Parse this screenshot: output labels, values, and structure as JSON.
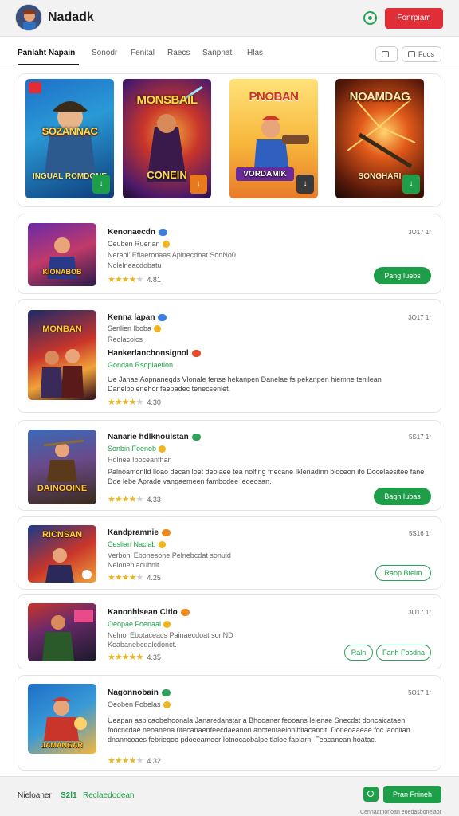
{
  "header": {
    "title": "Nadadk",
    "action_label": "Fonrpiam"
  },
  "tabs": [
    {
      "label": "Panlaht  Napain"
    },
    {
      "label": "Sonodr"
    },
    {
      "label": "Fenital"
    },
    {
      "label": "Raecs"
    },
    {
      "label": "Sanpnat"
    },
    {
      "label": "Hlas"
    }
  ],
  "toolbar": {
    "pill1": "",
    "pill2": "Fdos"
  },
  "featured": [
    {
      "title": "SOZANNAC",
      "subtitle": "INGUAL ROMDONE"
    },
    {
      "title": "MONSBAIL",
      "subtitle": "CONEIN"
    },
    {
      "title": "PNOBAN",
      "subtitle": "VORDAMIK"
    },
    {
      "title": "NOAMDAG",
      "subtitle": "SONGHARI"
    }
  ],
  "games": [
    {
      "title": "Kenonaecdn",
      "genre": "Ceuben  Ruerian",
      "line1": "Neraol'  Efiaeronaas  Apinecdoat  SonNo0",
      "line2": "Nolelneacdobatu",
      "rating": "4.81",
      "time": "3O17 1r",
      "button": "Pang Iuebs",
      "thumb": "KIONABOB"
    },
    {
      "title": "Kenna  lapan",
      "genre": "Senlien  Iboba",
      "line1": "Reolacoics",
      "subtitle2": "Hankerlanchonsignol",
      "subgreen": "Gondan  Rsoplaetion",
      "desc": "Ue Janae Aopnanegds Vlonale fense hekanpen Danelae fs pekanpen hiemne tenilean Danelbolenehor faepadec tenecsenlet.",
      "rating": "4.30",
      "time": "3O17 1r",
      "thumb": "MONBAN"
    },
    {
      "title": "Nanarie  hdlknoulstan",
      "genre": "Sonbin  Foenob",
      "line1": "Hdlnee  Iboceanfhan",
      "desc": "Palnoamonlld  lloao decan  loet deolaee  tea nolfing fnecane  Iklenadinn  bloceon  ifo Docelaesitee  fane  Doe lebe  Aprade  vangaemeen  fambodee  leoeosan.",
      "rating": "4.33",
      "time": "5S17 1r",
      "button": "Bagn Iubas",
      "thumb": "DAINOOINE"
    },
    {
      "title": "Kandpramnie",
      "genre": "Ceslian  Naclab",
      "line1": "Verbon'  Ebonesone  Pelnebcdat  sonuid",
      "line2": "Neloneniacubnit.",
      "rating": "4.25",
      "time": "5S16 1r",
      "button": "Raop  Bfelm",
      "thumb": "RICNSAN"
    },
    {
      "title": "Kanonhlsean  Cltlo",
      "genre": "Oeopae  Foenaal",
      "line1": "Nelnol  Ebotaceacs  Painaecdoat  sonND",
      "line2": "Keabanebcdalcdonct.",
      "rating": "4.35",
      "time": "3O17 1r",
      "button1": "Raln",
      "button2": "Fanh  Fosdna",
      "thumb": ""
    },
    {
      "title": "Nagonnobain",
      "genre": "Oeoben  Fobelas",
      "desc": "Ueapan  asplcaobehoonala  Janaredanstar  a  Bhooaner  feooans  lelenae  Snecdst  doncaicataen  foocncdae  neoanena  0fecanaenfeecdaeanon  anotentaelonlhitacanclt.  Doneoaaeae  foc  lacoltan  dnanncoaes  febriegoe  pdoeeameer  Iotnocaobalpe  tlaloe  faplarn.  Feacanean  hoatac.",
      "rating": "4.32",
      "time": "5O17 1r",
      "thumb": "JAMANGAR"
    }
  ],
  "footer": {
    "label": "Nieloaner",
    "count": "S2l1",
    "status": "Reclaedodean",
    "button": "Pran Fnineh",
    "note": "Cennaatnorloan  eoedasboneiaor"
  },
  "colors": {
    "brand_red": "#e02d36",
    "accent_green": "#1f9e4a"
  }
}
